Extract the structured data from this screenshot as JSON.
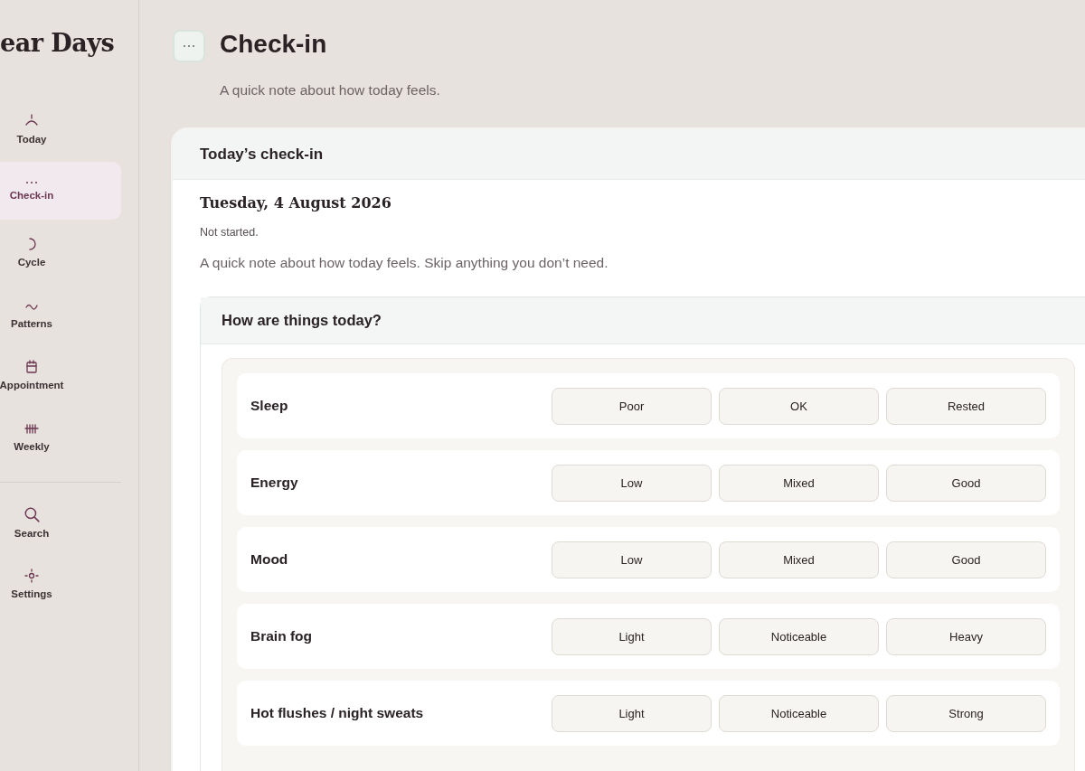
{
  "sidebar": {
    "brand": "ear Days",
    "items": [
      {
        "label": "Today",
        "kind": "horizon",
        "selected": false
      },
      {
        "label": "Check-in",
        "kind": "dots",
        "selected": true
      },
      {
        "label": "Cycle",
        "kind": "moon",
        "selected": false
      },
      {
        "label": "Patterns",
        "kind": "wave",
        "selected": false
      },
      {
        "label": "Appointment",
        "kind": "calendar",
        "selected": false
      },
      {
        "label": "Weekly",
        "kind": "tally",
        "selected": false
      }
    ],
    "bottom_items": [
      {
        "label": "Search",
        "kind": "search",
        "selected": false
      },
      {
        "label": "Settings",
        "kind": "sun",
        "selected": false
      }
    ]
  },
  "header": {
    "title": "Check-in",
    "subtitle": "A quick note about how today feels."
  },
  "card": {
    "title": "Today’s check-in",
    "date": "Tuesday, 4 August 2026",
    "status": "Not started.",
    "intro": "A quick note about how today feels. Skip anything you don’t need.",
    "section": {
      "title": "How are things today?",
      "rows": [
        {
          "label": "Sleep",
          "options": [
            {
              "label": "Poor",
              "selected": false
            },
            {
              "label": "OK",
              "selected": false
            },
            {
              "label": "Rested",
              "selected": false
            }
          ]
        },
        {
          "label": "Energy",
          "options": [
            {
              "label": "Low",
              "selected": false
            },
            {
              "label": "Mixed",
              "selected": false
            },
            {
              "label": "Good",
              "selected": false
            }
          ]
        },
        {
          "label": "Mood",
          "options": [
            {
              "label": "Low",
              "selected": false
            },
            {
              "label": "Mixed",
              "selected": false
            },
            {
              "label": "Good",
              "selected": false
            }
          ]
        },
        {
          "label": "Brain fog",
          "options": [
            {
              "label": "Light",
              "selected": false
            },
            {
              "label": "Noticeable",
              "selected": false
            },
            {
              "label": "Heavy",
              "selected": false
            }
          ]
        },
        {
          "label": "Hot flushes / night sweats",
          "options": [
            {
              "label": "Light",
              "selected": false
            },
            {
              "label": "Noticeable",
              "selected": false
            },
            {
              "label": "Strong",
              "selected": false
            }
          ]
        }
      ]
    }
  }
}
